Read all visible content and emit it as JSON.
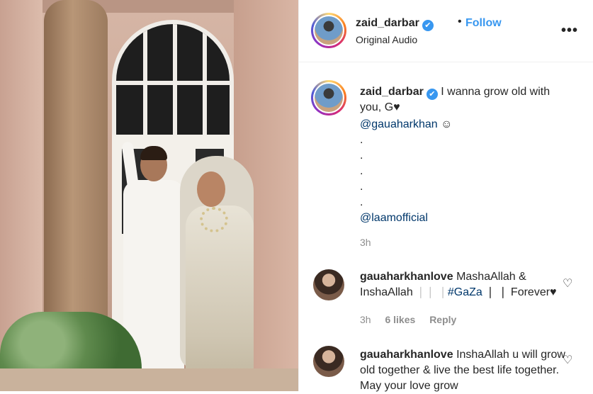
{
  "header": {
    "username": "zaid_darbar",
    "verified_mark": "✔",
    "separator": "•",
    "follow_label": "Follow",
    "audio": "Original Audio",
    "more": "•••"
  },
  "caption": {
    "username": "zaid_darbar",
    "verified_mark": "✔",
    "text": "I wanna grow old with you, G♥",
    "mention1": "@gauaharkhan",
    "emoji": "☺",
    "dots": [
      ".",
      ".",
      ".",
      ".",
      "."
    ],
    "mention2": "@laamofficial",
    "time": "3h"
  },
  "comments": [
    {
      "username": "gauaharkhanlove",
      "text_before": "MashaAllah & InshaAllah",
      "separators": "❘❘ ❘",
      "hashtag": "#GaZa",
      "text_after": "❘ ❘ Forever♥",
      "time": "3h",
      "likes": "6 likes",
      "reply": "Reply",
      "heart": "♡"
    },
    {
      "username": "gauaharkhanlove",
      "text": "InshaAllah u will grow old together & live the best life together. May your love grow",
      "heart": "♡"
    }
  ],
  "icons": {
    "heart": "heart-outline-icon",
    "more": "more-options-icon",
    "verified": "verified-badge-icon"
  },
  "colors": {
    "link": "#3897f0",
    "mention": "#00376b",
    "muted": "#8e8e8e"
  }
}
